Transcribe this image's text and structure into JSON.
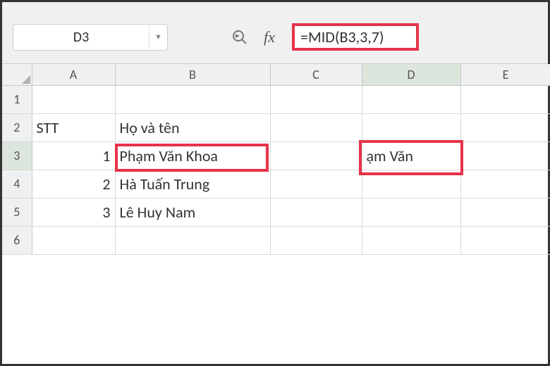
{
  "nameBox": {
    "value": "D3"
  },
  "formulaBar": {
    "formula": "=MID(B3,3,7)"
  },
  "columns": [
    "A",
    "B",
    "C",
    "D",
    "E"
  ],
  "rowNumbers": [
    "1",
    "2",
    "3",
    "4",
    "5",
    "6"
  ],
  "rows": {
    "r1": {
      "A": "",
      "B": "",
      "C": "",
      "D": "",
      "E": ""
    },
    "r2": {
      "A": "STT",
      "B": "Họ và tên",
      "C": "",
      "D": "",
      "E": ""
    },
    "r3": {
      "A": "1",
      "B": "Phạm Văn Khoa",
      "C": "",
      "D": "ạm Văn",
      "E": ""
    },
    "r4": {
      "A": "2",
      "B": "Hà Tuấn Trung",
      "C": "",
      "D": "",
      "E": ""
    },
    "r5": {
      "A": "3",
      "B": "Lê Huy Nam",
      "C": "",
      "D": "",
      "E": ""
    },
    "r6": {
      "A": "",
      "B": "",
      "C": "",
      "D": "",
      "E": ""
    }
  },
  "activeCell": "D3"
}
